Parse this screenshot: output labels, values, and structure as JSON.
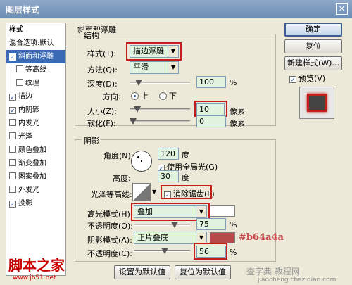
{
  "window": {
    "title": "图层样式",
    "close_glyph": "✕"
  },
  "style_list": {
    "header": "样式",
    "items": [
      {
        "label": "混合选项:默认",
        "checkbox": false,
        "checked": false,
        "sub": false,
        "selected": false
      },
      {
        "label": "斜面和浮雕",
        "checkbox": true,
        "checked": true,
        "sub": false,
        "selected": true
      },
      {
        "label": "等高线",
        "checkbox": true,
        "checked": false,
        "sub": true,
        "selected": false
      },
      {
        "label": "纹理",
        "checkbox": true,
        "checked": false,
        "sub": true,
        "selected": false
      },
      {
        "label": "描边",
        "checkbox": true,
        "checked": true,
        "sub": false,
        "selected": false
      },
      {
        "label": "内阴影",
        "checkbox": true,
        "checked": true,
        "sub": false,
        "selected": false
      },
      {
        "label": "内发光",
        "checkbox": true,
        "checked": false,
        "sub": false,
        "selected": false
      },
      {
        "label": "光泽",
        "checkbox": true,
        "checked": false,
        "sub": false,
        "selected": false
      },
      {
        "label": "颜色叠加",
        "checkbox": true,
        "checked": false,
        "sub": false,
        "selected": false
      },
      {
        "label": "渐变叠加",
        "checkbox": true,
        "checked": false,
        "sub": false,
        "selected": false
      },
      {
        "label": "图案叠加",
        "checkbox": true,
        "checked": false,
        "sub": false,
        "selected": false
      },
      {
        "label": "外发光",
        "checkbox": true,
        "checked": false,
        "sub": false,
        "selected": false
      },
      {
        "label": "投影",
        "checkbox": true,
        "checked": true,
        "sub": false,
        "selected": false
      }
    ]
  },
  "bevel": {
    "title": "斜面和浮雕",
    "structure": {
      "title": "结构",
      "style_label": "样式(T):",
      "style_value": "描边浮雕",
      "technique_label": "方法(Q):",
      "technique_value": "平滑",
      "depth_label": "深度(D):",
      "depth_value": "100",
      "depth_unit": "%",
      "depth_fraction": 0.1,
      "direction_label": "方向:",
      "direction_up": "上",
      "direction_down": "下",
      "size_label": "大小(Z):",
      "size_value": "10",
      "size_unit": "像素",
      "size_fraction": 0.08,
      "soften_label": "软化(F):",
      "soften_value": "0",
      "soften_unit": "像素",
      "soften_fraction": 0.0
    },
    "shading": {
      "title": "阴影",
      "angle_label": "角度(N):",
      "angle_value": "120",
      "angle_unit": "度",
      "global_light_label": "使用全局光(G)",
      "altitude_label": "高度:",
      "altitude_value": "30",
      "altitude_unit": "度",
      "gloss_contour_label": "光泽等高线:",
      "anti_alias_label": "消除锯齿(L)",
      "highlight_mode_label": "高光模式(H):",
      "highlight_mode_value": "叠加",
      "highlight_color": "#ffffff",
      "highlight_opacity_label": "不透明度(O):",
      "highlight_opacity_value": "75",
      "highlight_opacity_unit": "%",
      "highlight_opacity_fraction": 0.75,
      "shadow_mode_label": "阴影模式(A):",
      "shadow_mode_value": "正片叠底",
      "shadow_color": "#b64a4a",
      "shadow_opacity_label": "不透明度(C):",
      "shadow_opacity_value": "56",
      "shadow_opacity_unit": "%",
      "shadow_opacity_fraction": 0.56
    },
    "make_default": "设置为默认值",
    "reset_default": "复位为默认值"
  },
  "buttons": {
    "ok": "确定",
    "reset": "复位",
    "new_style": "新建样式(W)...",
    "preview": "预览(V)"
  },
  "annotation": {
    "color_hex": "#b64a4a"
  },
  "watermarks": {
    "left": "脚本之家",
    "left_url": "www.jb51.net",
    "right": "查字典 教程网",
    "right_url": "jiaocheng.chazidian.com"
  },
  "colors": {
    "highlight_box": "#c41d1d",
    "selection": "#3b6ab5",
    "field_bg": "#dff3de"
  }
}
